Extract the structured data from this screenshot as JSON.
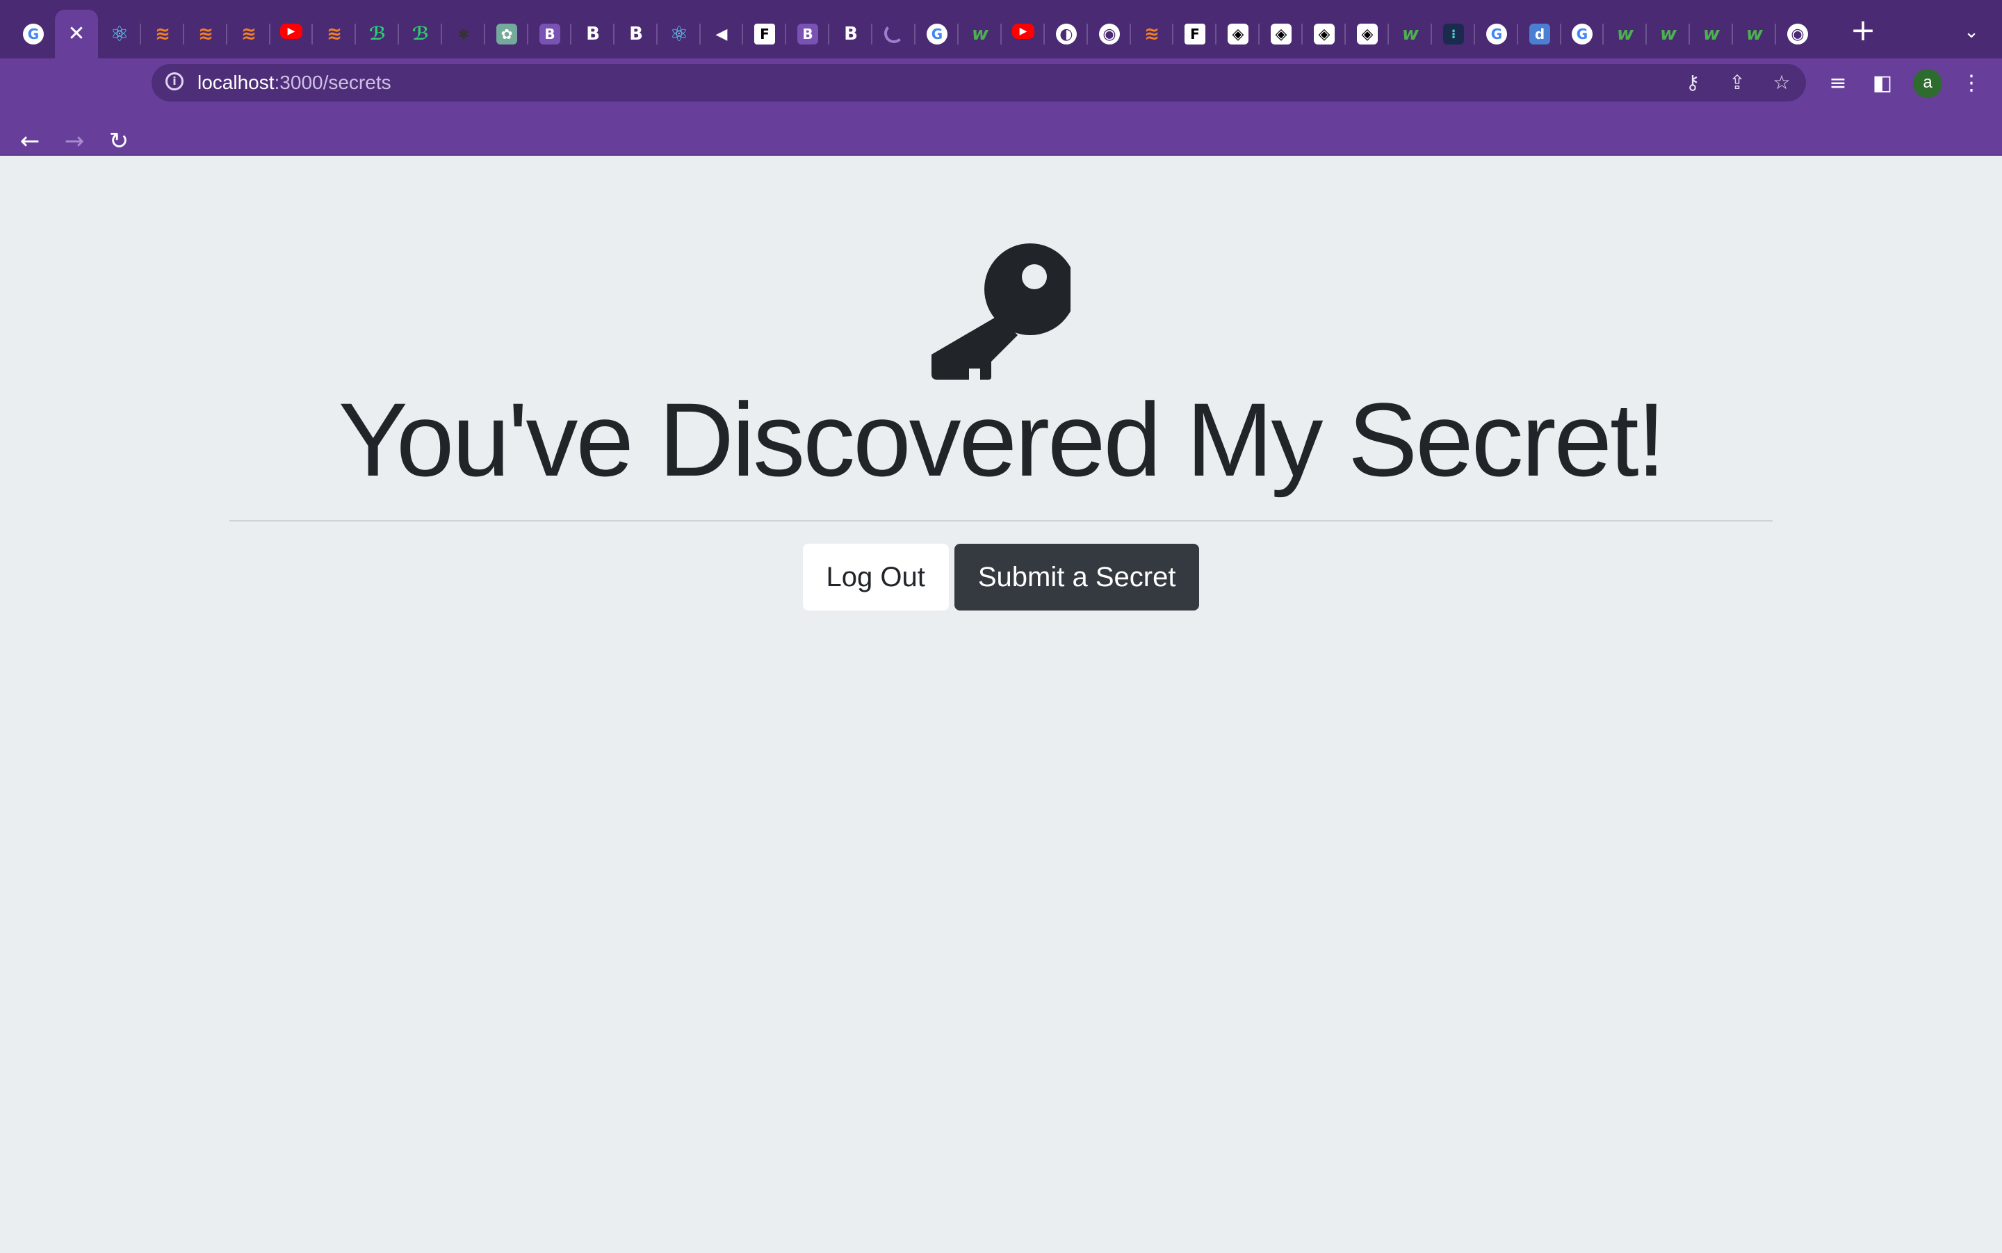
{
  "browser": {
    "tabs": [
      {
        "icon": "google-icon",
        "glyph": "G",
        "style": "fav-google"
      },
      {
        "icon": "close-icon",
        "glyph": "✕",
        "style": "active"
      },
      {
        "icon": "react-icon",
        "glyph": "⚛",
        "style": "fav-react"
      },
      {
        "icon": "stackoverflow-icon",
        "glyph": "≋",
        "style": "fav-so"
      },
      {
        "icon": "stackoverflow-icon",
        "glyph": "≋",
        "style": "fav-so"
      },
      {
        "icon": "stackoverflow-icon",
        "glyph": "≋",
        "style": "fav-so"
      },
      {
        "icon": "youtube-icon",
        "glyph": "▶",
        "style": "fav-yt"
      },
      {
        "icon": "stackoverflow-icon",
        "glyph": "≋",
        "style": "fav-so"
      },
      {
        "icon": "gatsby-icon",
        "glyph": "ℬ",
        "style": "fav-gatsby"
      },
      {
        "icon": "gatsby-icon",
        "glyph": "ℬ",
        "style": "fav-gatsby"
      },
      {
        "icon": "dark-site-icon",
        "glyph": "✱",
        "style": "fav-blank"
      },
      {
        "icon": "chatgpt-icon",
        "glyph": "✿",
        "style": "fav-gpt"
      },
      {
        "icon": "bootstrap-icon",
        "glyph": "B",
        "style": "fav-b-purple"
      },
      {
        "icon": "bootstrap-icon",
        "glyph": "B",
        "style": "fav-b-dark"
      },
      {
        "icon": "bootstrap-icon",
        "glyph": "B",
        "style": "fav-b-dark"
      },
      {
        "icon": "react-bootstrap-icon",
        "glyph": "⚛",
        "style": "fav-react"
      },
      {
        "icon": "mute-icon",
        "glyph": "◀",
        "style": "fav-mute"
      },
      {
        "icon": "figma-icon",
        "glyph": "F",
        "style": "fav-figma"
      },
      {
        "icon": "bootstrap-icon",
        "glyph": "B",
        "style": "fav-b-purple"
      },
      {
        "icon": "bootstrap-icon",
        "glyph": "B",
        "style": "fav-b-dark"
      },
      {
        "icon": "loading-spinner-icon",
        "glyph": "",
        "style": "fav-spin"
      },
      {
        "icon": "google-icon",
        "glyph": "G",
        "style": "fav-google"
      },
      {
        "icon": "w3-icon",
        "glyph": "w",
        "style": "fav-w"
      },
      {
        "icon": "youtube-icon",
        "glyph": "▶",
        "style": "fav-yt"
      },
      {
        "icon": "globe-icon",
        "glyph": "◐",
        "style": "fav-globe"
      },
      {
        "icon": "chrome-icon",
        "glyph": "◉",
        "style": "fav-chrome"
      },
      {
        "icon": "stackoverflow-icon",
        "glyph": "≋",
        "style": "fav-so"
      },
      {
        "icon": "figma-icon",
        "glyph": "F",
        "style": "fav-figma"
      },
      {
        "icon": "codepen-icon",
        "glyph": "◈",
        "style": "fav-codepen"
      },
      {
        "icon": "codepen-icon",
        "glyph": "◈",
        "style": "fav-codepen"
      },
      {
        "icon": "codepen-icon",
        "glyph": "◈",
        "style": "fav-codepen"
      },
      {
        "icon": "codepen-icon",
        "glyph": "◈",
        "style": "fav-codepen"
      },
      {
        "icon": "w3-icon",
        "glyph": "w",
        "style": "fav-w"
      },
      {
        "icon": "chakra-icon",
        "glyph": "⁝",
        "style": "fav-chakra"
      },
      {
        "icon": "google-icon",
        "glyph": "G",
        "style": "fav-google"
      },
      {
        "icon": "d-site-icon",
        "glyph": "d",
        "style": "fav-d"
      },
      {
        "icon": "google-icon",
        "glyph": "G",
        "style": "fav-google"
      },
      {
        "icon": "w3-icon",
        "glyph": "w",
        "style": "fav-w"
      },
      {
        "icon": "w3-icon",
        "glyph": "w",
        "style": "fav-w"
      },
      {
        "icon": "w3-icon",
        "glyph": "w",
        "style": "fav-w"
      },
      {
        "icon": "w3-icon",
        "glyph": "w",
        "style": "fav-w"
      },
      {
        "icon": "chrome-icon",
        "glyph": "◉",
        "style": "fav-chrome"
      }
    ],
    "new_tab_glyph": "+",
    "tab_menu_glyph": "⌄",
    "back_glyph": "←",
    "forward_glyph": "→",
    "reload_glyph": "↻",
    "url_host": "localhost",
    "url_path": ":3000/secrets",
    "key_glyph": "⚷",
    "share_glyph": "⇪",
    "star_glyph": "☆",
    "media_glyph": "≡",
    "sidepanel_glyph": "◧",
    "profile_initial": "a",
    "menu_glyph": "⋮"
  },
  "page": {
    "headline": "You've Discovered My Secret!",
    "logout_label": "Log Out",
    "submit_label": "Submit a Secret"
  },
  "colors": {
    "tabstrip": "#4a2a73",
    "toolbar": "#673f9b",
    "page_bg": "#ebeef1",
    "text_dark": "#212529",
    "btn_dark": "#343a40"
  }
}
